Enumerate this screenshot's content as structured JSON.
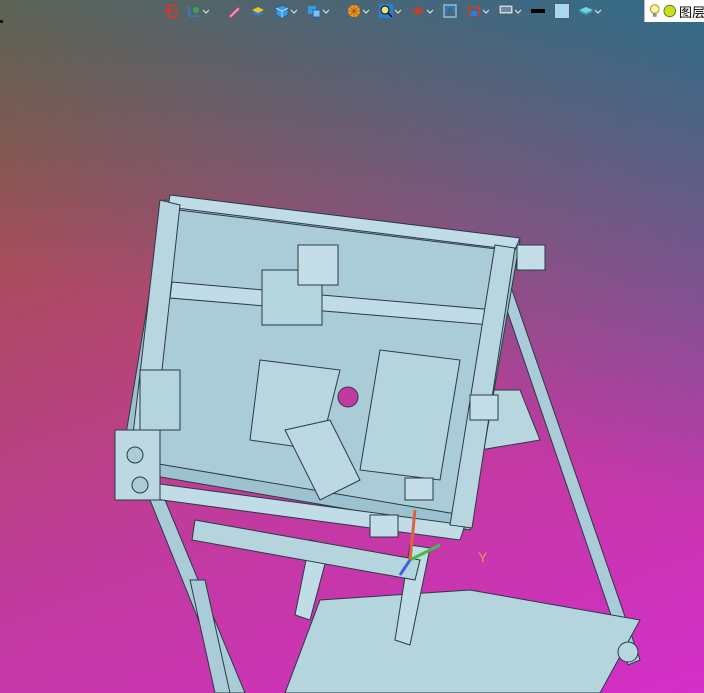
{
  "toolbar": {
    "items": [
      {
        "name": "exit-sketch-icon",
        "has_dropdown": false
      },
      {
        "name": "ucs-icon",
        "has_dropdown": true
      },
      {
        "name": "pencil-icon",
        "has_dropdown": false
      },
      {
        "name": "extrude-icon",
        "has_dropdown": false
      },
      {
        "name": "box-icon",
        "has_dropdown": true
      },
      {
        "name": "mesh-icon",
        "has_dropdown": true
      },
      {
        "name": "render-icon",
        "has_dropdown": true
      },
      {
        "name": "zoom-icon",
        "has_dropdown": true
      },
      {
        "name": "pan-icon",
        "has_dropdown": true
      },
      {
        "name": "rotate-icon",
        "has_dropdown": false
      },
      {
        "name": "section-icon",
        "has_dropdown": true
      },
      {
        "name": "monitor-icon",
        "has_dropdown": true
      },
      {
        "name": "lineweight-icon",
        "has_dropdown": false
      },
      {
        "name": "color-swatch-icon",
        "has_dropdown": false
      },
      {
        "name": "layer-stack-icon",
        "has_dropdown": true
      }
    ],
    "colors": {
      "accent_blue": "#2a7fd4",
      "accent_red": "#d43a2a",
      "swatch": "#a9d6f0",
      "lineweight": "#000000"
    }
  },
  "layer": {
    "label": "图层",
    "bulb_icon": "lightbulb-icon",
    "status_icon": "layer-on-icon",
    "status_color": "#c8e020"
  },
  "viewport": {
    "axis_label": "Y",
    "model_color": "#a9ccd8",
    "edge_color": "#2a3a44"
  }
}
